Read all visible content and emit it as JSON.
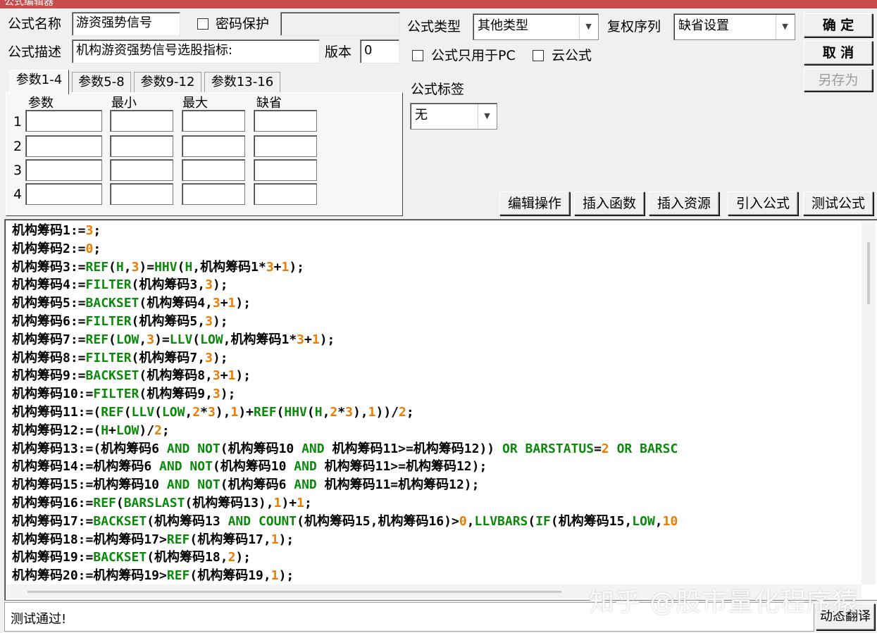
{
  "window": {
    "title": "公式编辑器"
  },
  "top": {
    "name_label": "公式名称",
    "name_value": "游资强势信号",
    "password_label": "密码保护",
    "password_value": "",
    "desc_label": "公式描述",
    "desc_value": "机构游资强势信号选股指标:",
    "version_label": "版本",
    "version_value": "0",
    "type_label": "公式类型",
    "type_value": "其他类型",
    "rights_label": "复权序列",
    "rights_value": "缺省设置",
    "pc_only_label": "公式只用于PC",
    "cloud_label": "云公式",
    "tag_label": "公式标签",
    "tag_value": "无"
  },
  "buttons": {
    "ok": "确 定",
    "cancel": "取 消",
    "save_as": "另存为",
    "edit_ops": "编辑操作",
    "insert_func": "插入函数",
    "insert_res": "插入资源",
    "import_formula": "引入公式",
    "test_formula": "测试公式",
    "dynamic_translate": "动态翻译"
  },
  "params": {
    "tabs": [
      "参数1-4",
      "参数5-8",
      "参数9-12",
      "参数13-16"
    ],
    "active_tab": 0,
    "headers": [
      "参数",
      "最小",
      "最大",
      "缺省"
    ],
    "rows": [
      "1",
      "2",
      "3",
      "4"
    ]
  },
  "code_lines": [
    [
      [
        "t",
        "机构筹码1:="
      ],
      [
        "n",
        "3"
      ],
      [
        "t",
        ";"
      ]
    ],
    [
      [
        "t",
        "机构筹码2:="
      ],
      [
        "n",
        "0"
      ],
      [
        "t",
        ";"
      ]
    ],
    [
      [
        "t",
        "机构筹码3:="
      ],
      [
        "k",
        "REF"
      ],
      [
        "t",
        "("
      ],
      [
        "k",
        "H"
      ],
      [
        "t",
        ","
      ],
      [
        "n",
        "3"
      ],
      [
        "t",
        ")="
      ],
      [
        "k",
        "HHV"
      ],
      [
        "t",
        "("
      ],
      [
        "k",
        "H"
      ],
      [
        "t",
        ",机构筹码1*"
      ],
      [
        "n",
        "3"
      ],
      [
        "t",
        "+"
      ],
      [
        "n",
        "1"
      ],
      [
        "t",
        ");"
      ]
    ],
    [
      [
        "t",
        "机构筹码4:="
      ],
      [
        "k",
        "FILTER"
      ],
      [
        "t",
        "(机构筹码3,"
      ],
      [
        "n",
        "3"
      ],
      [
        "t",
        ");"
      ]
    ],
    [
      [
        "t",
        "机构筹码5:="
      ],
      [
        "k",
        "BACKSET"
      ],
      [
        "t",
        "(机构筹码4,"
      ],
      [
        "n",
        "3"
      ],
      [
        "t",
        "+"
      ],
      [
        "n",
        "1"
      ],
      [
        "t",
        ");"
      ]
    ],
    [
      [
        "t",
        "机构筹码6:="
      ],
      [
        "k",
        "FILTER"
      ],
      [
        "t",
        "(机构筹码5,"
      ],
      [
        "n",
        "3"
      ],
      [
        "t",
        ");"
      ]
    ],
    [
      [
        "t",
        "机构筹码7:="
      ],
      [
        "k",
        "REF"
      ],
      [
        "t",
        "("
      ],
      [
        "k",
        "LOW"
      ],
      [
        "t",
        ","
      ],
      [
        "n",
        "3"
      ],
      [
        "t",
        ")="
      ],
      [
        "k",
        "LLV"
      ],
      [
        "t",
        "("
      ],
      [
        "k",
        "LOW"
      ],
      [
        "t",
        ",机构筹码1*"
      ],
      [
        "n",
        "3"
      ],
      [
        "t",
        "+"
      ],
      [
        "n",
        "1"
      ],
      [
        "t",
        ");"
      ]
    ],
    [
      [
        "t",
        "机构筹码8:="
      ],
      [
        "k",
        "FILTER"
      ],
      [
        "t",
        "(机构筹码7,"
      ],
      [
        "n",
        "3"
      ],
      [
        "t",
        ");"
      ]
    ],
    [
      [
        "t",
        "机构筹码9:="
      ],
      [
        "k",
        "BACKSET"
      ],
      [
        "t",
        "(机构筹码8,"
      ],
      [
        "n",
        "3"
      ],
      [
        "t",
        "+"
      ],
      [
        "n",
        "1"
      ],
      [
        "t",
        ");"
      ]
    ],
    [
      [
        "t",
        "机构筹码10:="
      ],
      [
        "k",
        "FILTER"
      ],
      [
        "t",
        "(机构筹码9,"
      ],
      [
        "n",
        "3"
      ],
      [
        "t",
        ");"
      ]
    ],
    [
      [
        "t",
        "机构筹码11:=("
      ],
      [
        "k",
        "REF"
      ],
      [
        "t",
        "("
      ],
      [
        "k",
        "LLV"
      ],
      [
        "t",
        "("
      ],
      [
        "k",
        "LOW"
      ],
      [
        "t",
        ","
      ],
      [
        "n",
        "2"
      ],
      [
        "t",
        "*"
      ],
      [
        "n",
        "3"
      ],
      [
        "t",
        "),"
      ],
      [
        "n",
        "1"
      ],
      [
        "t",
        ")+"
      ],
      [
        "k",
        "REF"
      ],
      [
        "t",
        "("
      ],
      [
        "k",
        "HHV"
      ],
      [
        "t",
        "("
      ],
      [
        "k",
        "H"
      ],
      [
        "t",
        ","
      ],
      [
        "n",
        "2"
      ],
      [
        "t",
        "*"
      ],
      [
        "n",
        "3"
      ],
      [
        "t",
        "),"
      ],
      [
        "n",
        "1"
      ],
      [
        "t",
        "))/"
      ],
      [
        "n",
        "2"
      ],
      [
        "t",
        ";"
      ]
    ],
    [
      [
        "t",
        "机构筹码12:=("
      ],
      [
        "k",
        "H"
      ],
      [
        "t",
        "+"
      ],
      [
        "k",
        "LOW"
      ],
      [
        "t",
        ")/"
      ],
      [
        "n",
        "2"
      ],
      [
        "t",
        ";"
      ]
    ],
    [
      [
        "t",
        "机构筹码13:=(机构筹码6 "
      ],
      [
        "k",
        "AND"
      ],
      [
        "t",
        " "
      ],
      [
        "k",
        "NOT"
      ],
      [
        "t",
        "(机构筹码10 "
      ],
      [
        "k",
        "AND"
      ],
      [
        "t",
        " 机构筹码11>=机构筹码12)) "
      ],
      [
        "k",
        "OR"
      ],
      [
        "t",
        " "
      ],
      [
        "k",
        "BARSTATUS"
      ],
      [
        "t",
        "="
      ],
      [
        "n",
        "2"
      ],
      [
        "t",
        " "
      ],
      [
        "k",
        "OR"
      ],
      [
        "t",
        " "
      ],
      [
        "k",
        "BARSC"
      ]
    ],
    [
      [
        "t",
        "机构筹码14:=机构筹码6 "
      ],
      [
        "k",
        "AND"
      ],
      [
        "t",
        " "
      ],
      [
        "k",
        "NOT"
      ],
      [
        "t",
        "(机构筹码10 "
      ],
      [
        "k",
        "AND"
      ],
      [
        "t",
        " 机构筹码11>=机构筹码12);"
      ]
    ],
    [
      [
        "t",
        "机构筹码15:=机构筹码10 "
      ],
      [
        "k",
        "AND"
      ],
      [
        "t",
        " "
      ],
      [
        "k",
        "NOT"
      ],
      [
        "t",
        "(机构筹码6 "
      ],
      [
        "k",
        "AND"
      ],
      [
        "t",
        " 机构筹码11=机构筹码12);"
      ]
    ],
    [
      [
        "t",
        "机构筹码16:="
      ],
      [
        "k",
        "REF"
      ],
      [
        "t",
        "("
      ],
      [
        "k",
        "BARSLAST"
      ],
      [
        "t",
        "(机构筹码13),"
      ],
      [
        "n",
        "1"
      ],
      [
        "t",
        ")+"
      ],
      [
        "n",
        "1"
      ],
      [
        "t",
        ";"
      ]
    ],
    [
      [
        "t",
        "机构筹码17:="
      ],
      [
        "k",
        "BACKSET"
      ],
      [
        "t",
        "(机构筹码13 "
      ],
      [
        "k",
        "AND"
      ],
      [
        "t",
        " "
      ],
      [
        "k",
        "COUNT"
      ],
      [
        "t",
        "(机构筹码15,机构筹码16)>"
      ],
      [
        "n",
        "0"
      ],
      [
        "t",
        ","
      ],
      [
        "k",
        "LLVBARS"
      ],
      [
        "t",
        "("
      ],
      [
        "k",
        "IF"
      ],
      [
        "t",
        "(机构筹码15,"
      ],
      [
        "k",
        "LOW"
      ],
      [
        "t",
        ","
      ],
      [
        "n",
        "10"
      ]
    ],
    [
      [
        "t",
        "机构筹码18:=机构筹码17>"
      ],
      [
        "k",
        "REF"
      ],
      [
        "t",
        "(机构筹码17,"
      ],
      [
        "n",
        "1"
      ],
      [
        "t",
        ");"
      ]
    ],
    [
      [
        "t",
        "机构筹码19:="
      ],
      [
        "k",
        "BACKSET"
      ],
      [
        "t",
        "(机构筹码18,"
      ],
      [
        "n",
        "2"
      ],
      [
        "t",
        ");"
      ]
    ],
    [
      [
        "t",
        "机构筹码20:=机构筹码19>"
      ],
      [
        "k",
        "REF"
      ],
      [
        "t",
        "(机构筹码19,"
      ],
      [
        "n",
        "1"
      ],
      [
        "t",
        ");"
      ]
    ]
  ],
  "status": {
    "message": "测试通过!"
  },
  "watermark": "知乎 @股市量化程序猿",
  "colors": {
    "keyword": "#0a8a0a",
    "number": "#ee7a00",
    "titlebar": "#c94b4b"
  }
}
